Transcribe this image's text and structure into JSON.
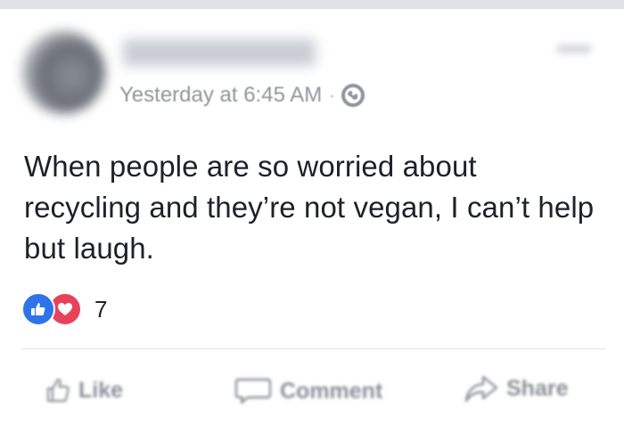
{
  "post": {
    "timestamp": "Yesterday at 6:45 AM",
    "separator": "·",
    "privacy_icon": "globe-icon",
    "text": "When people are so worried about recycling and they’re not vegan, I can’t help but laugh.",
    "reactions": {
      "icons": [
        "like-reaction-icon",
        "love-reaction-icon"
      ],
      "count": "7"
    }
  },
  "actions": {
    "like_label": "Like",
    "comment_label": "Comment",
    "share_label": "Share"
  },
  "colors": {
    "like_blue": "#2e73e8",
    "love_red": "#e8425a",
    "meta_gray": "#90949c",
    "text": "#1d2129"
  }
}
